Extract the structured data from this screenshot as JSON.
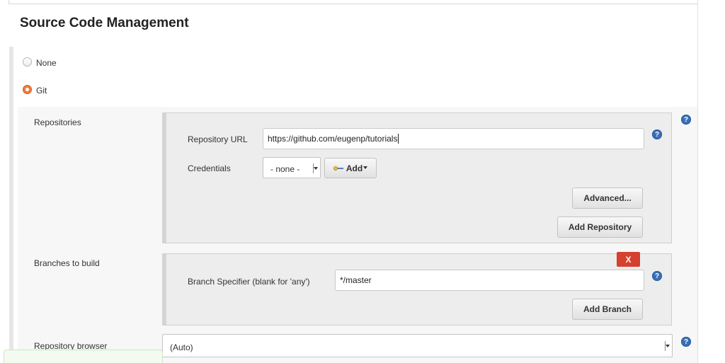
{
  "section": {
    "title": "Source Code Management"
  },
  "scm_options": [
    {
      "label": "None",
      "checked": false
    },
    {
      "label": "Git",
      "checked": true
    }
  ],
  "repositories": {
    "label": "Repositories",
    "url_label": "Repository URL",
    "url_value": "https://github.com/eugenp/tutorials",
    "credentials_label": "Credentials",
    "credentials_value": "- none -",
    "add_label": "Add",
    "advanced_label": "Advanced...",
    "add_repository_label": "Add Repository"
  },
  "branches": {
    "label": "Branches to build",
    "delete_label": "X",
    "specifier_label": "Branch Specifier (blank for 'any')",
    "specifier_value": "*/master",
    "add_branch_label": "Add Branch"
  },
  "repo_browser": {
    "label": "Repository browser",
    "value": "(Auto)"
  },
  "help_icon_text": "?",
  "colors": {
    "accent_radio": "#f07a3b",
    "help_icon": "#3a6fb5",
    "delete_button": "#d6402e"
  }
}
